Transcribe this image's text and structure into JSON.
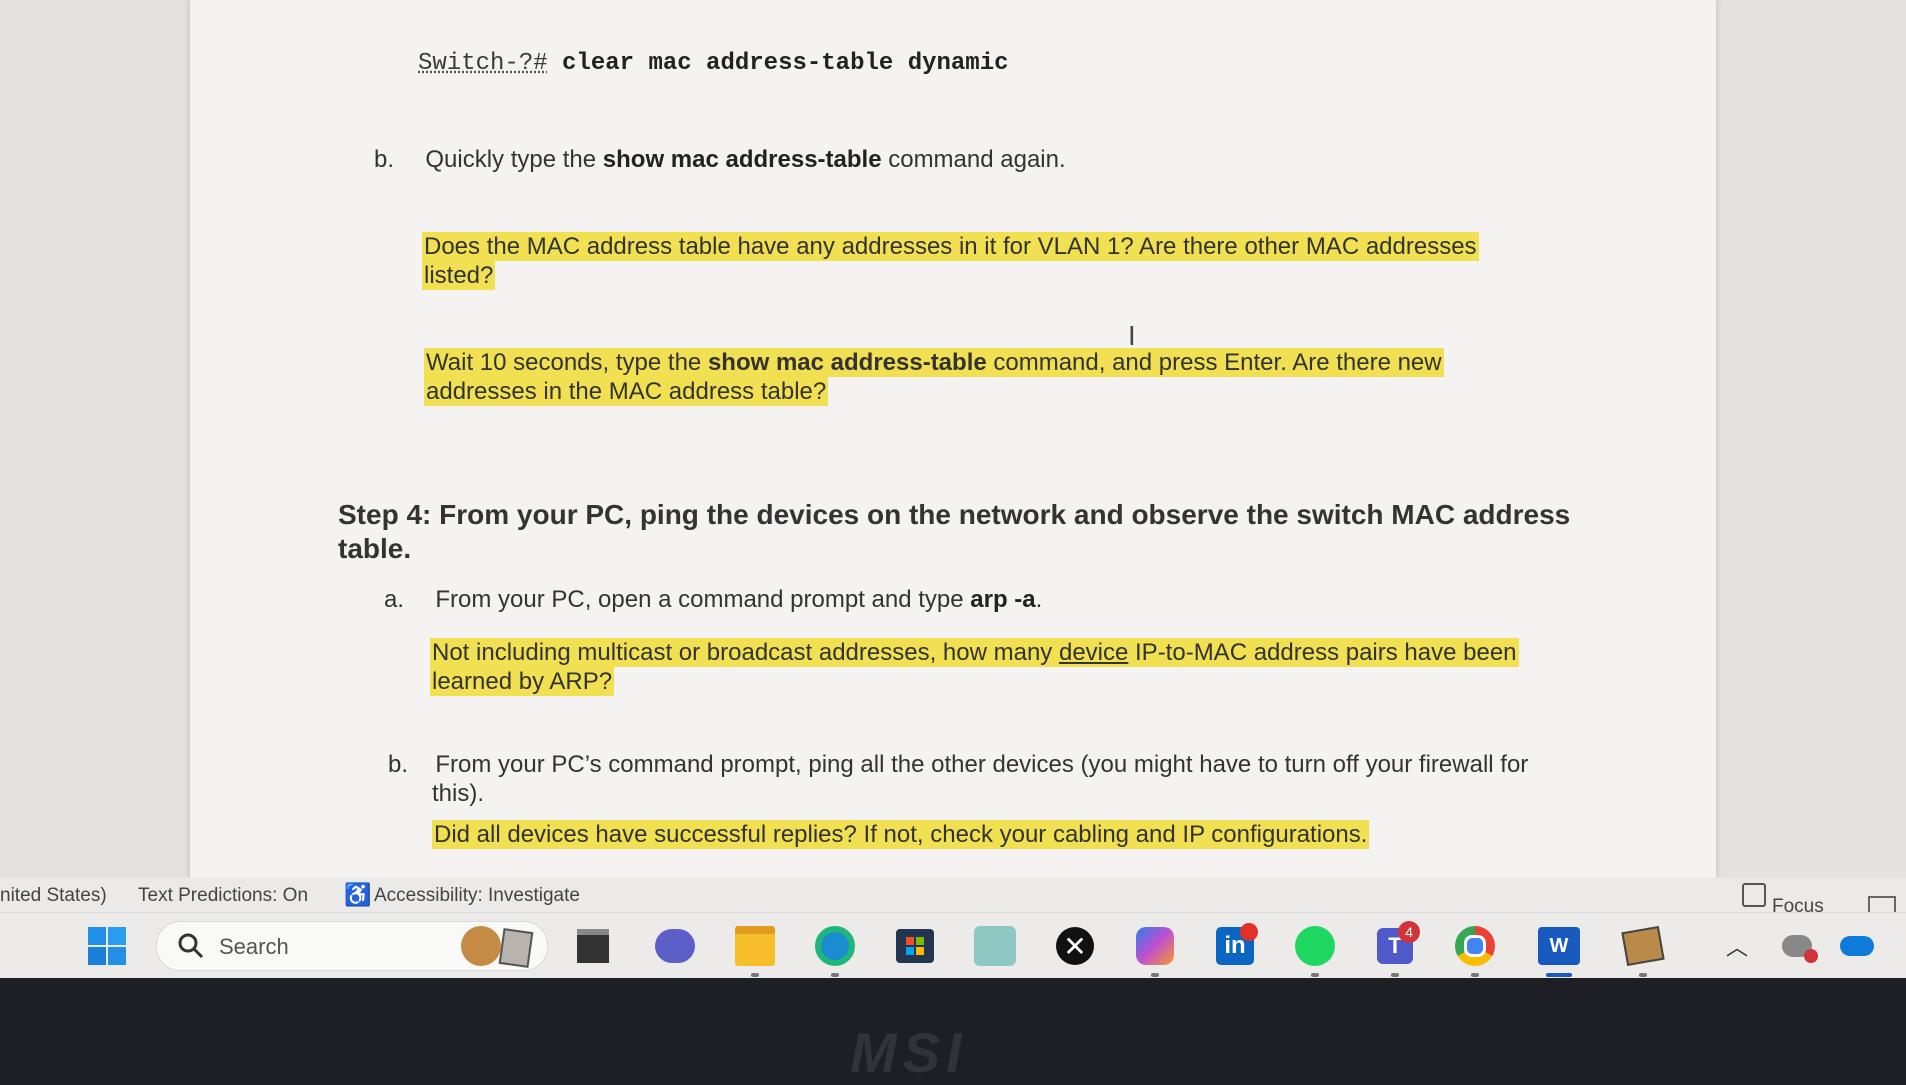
{
  "document": {
    "command_prompt": "Switch-?#",
    "command_text": "clear mac address-table dynamic",
    "item_b1": {
      "label": "b.",
      "pre": "Quickly type the ",
      "bold": "show mac address-table",
      "post": " command again."
    },
    "question1_line1": "Does the MAC address table have any addresses in it for VLAN 1? Are there other MAC addresses",
    "question1_line2": "listed?",
    "question2_line1_pre": "Wait 10 seconds, type the ",
    "question2_line1_bold": "show mac address-table",
    "question2_line1_post": " command, and press Enter. Are there new",
    "question2_line2": "addresses in the MAC address table?",
    "step4_title": "Step 4: From your PC, ping the devices on the network and observe the switch MAC address table.",
    "item_a": {
      "label": "a.",
      "pre": "From your PC, open a command prompt and type ",
      "bold": "arp -a",
      "post": "."
    },
    "question3_line1_pre": "Not including multicast or broadcast addresses, how many ",
    "question3_line1_link": "device",
    "question3_line1_post": " IP-to-MAC address pairs have been",
    "question3_line2": "learned by ARP?",
    "item_b2": {
      "label": "b.",
      "line1": "From your PC’s command prompt, ping all the other devices (you might have to turn off your firewall for",
      "line2": "this)."
    },
    "question4": "Did all devices have successful replies? If not, check your cabling and IP configurations."
  },
  "statusbar": {
    "language": "nited States)",
    "text_predictions": "Text Predictions: On",
    "accessibility": "Accessibility: Investigate",
    "focus": "Focus"
  },
  "taskbar": {
    "search_label": "Search",
    "teams_badge": "4",
    "icons": [
      "windows-start-icon",
      "search-icon",
      "widgets-icon",
      "task-view-icon",
      "chat-icon",
      "file-explorer-icon",
      "edge-icon",
      "store-icon",
      "copilot-app-icon",
      "xbox-icon",
      "copilot-icon",
      "linkedin-icon",
      "spotify-icon",
      "teams-icon",
      "chrome-icon",
      "word-icon",
      "app-icon"
    ]
  },
  "colors": {
    "highlight": "#f0e052",
    "page": "#f4f3f1",
    "taskbar": "#ecebea"
  },
  "bezel_brand": "MSI"
}
